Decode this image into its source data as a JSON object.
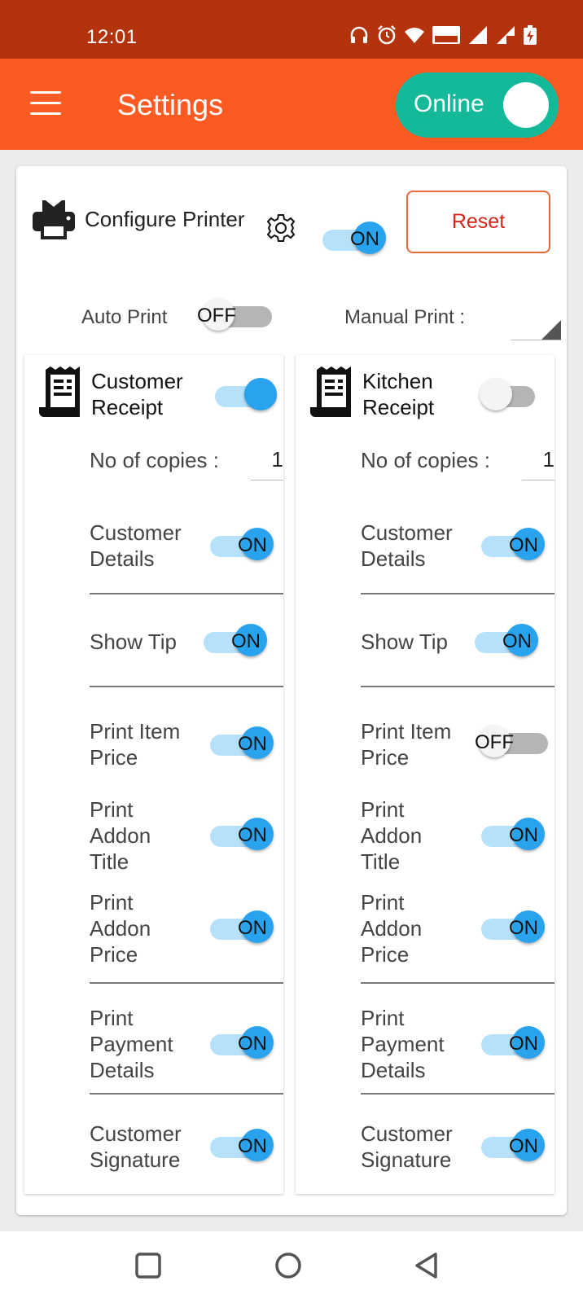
{
  "status_bar": {
    "time": "12:01",
    "icons": [
      "headphones-icon",
      "alarm-icon",
      "wifi-icon",
      "volte-icon",
      "signal-icon",
      "signal-roaming-icon",
      "battery-charging-icon"
    ]
  },
  "app_bar": {
    "title": "Settings",
    "online_toggle": {
      "label": "Online",
      "state": true
    }
  },
  "printer": {
    "configure_label": "Configure Printer",
    "enabled_switch": "ON",
    "reset_label": "Reset",
    "auto_print_label": "Auto Print",
    "auto_print_switch": "OFF",
    "manual_print_label": "Manual Print :",
    "manual_print_value": ""
  },
  "receipts": [
    {
      "title_line1": "Customer",
      "title_line2": "Receipt",
      "enabled": true,
      "copies_label": "No of copies :",
      "copies_value": "1",
      "options": {
        "customer_details": {
          "line1": "Customer",
          "line2": "Details",
          "switch": "ON"
        },
        "show_tip": {
          "line1": "Show Tip",
          "switch": "ON"
        },
        "print_item_price": {
          "line1": "Print Item",
          "line2": "Price",
          "switch": "ON"
        },
        "print_addon_title": {
          "line1": "Print",
          "line2": "Addon",
          "line3": "Title",
          "switch": "ON"
        },
        "print_addon_price": {
          "line1": "Print",
          "line2": "Addon",
          "line3": "Price",
          "switch": "ON"
        },
        "print_payment_details": {
          "line1": "Print",
          "line2": "Payment",
          "line3": "Details",
          "switch": "ON"
        },
        "customer_signature": {
          "line1": "Customer",
          "line2": "Signature",
          "switch": "ON"
        }
      }
    },
    {
      "title_line1": "Kitchen",
      "title_line2": "Receipt",
      "enabled": false,
      "copies_label": "No of copies :",
      "copies_value": "1",
      "options": {
        "customer_details": {
          "line1": "Customer",
          "line2": "Details",
          "switch": "ON"
        },
        "show_tip": {
          "line1": "Show Tip",
          "switch": "ON"
        },
        "print_item_price": {
          "line1": "Print Item",
          "line2": "Price",
          "switch": "OFF"
        },
        "print_addon_title": {
          "line1": "Print",
          "line2": "Addon",
          "line3": "Title",
          "switch": "ON"
        },
        "print_addon_price": {
          "line1": "Print",
          "line2": "Addon",
          "line3": "Price",
          "switch": "ON"
        },
        "print_payment_details": {
          "line1": "Print",
          "line2": "Payment",
          "line3": "Details",
          "switch": "ON"
        },
        "customer_signature": {
          "line1": "Customer",
          "line2": "Signature",
          "switch": "ON"
        }
      }
    }
  ],
  "colors": {
    "status_bar": "#b3330d",
    "app_bar": "#fb5a22",
    "online_toggle": "#14b99a",
    "switch_on_thumb": "#2aa3ef",
    "switch_on_track": "#b5e1fb",
    "reset_text": "#d5261c"
  },
  "nav_bar": {
    "icons": [
      "recent-apps-icon",
      "home-icon",
      "back-icon"
    ]
  }
}
